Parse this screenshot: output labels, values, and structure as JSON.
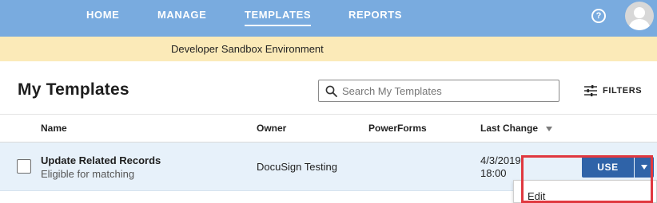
{
  "nav": {
    "items": [
      "HOME",
      "MANAGE",
      "TEMPLATES",
      "REPORTS"
    ],
    "active": "TEMPLATES",
    "help_icon": "help-circle-icon",
    "help_glyph": "?",
    "avatar_icon": "user-avatar-icon"
  },
  "banner": {
    "text": "Developer Sandbox Environment"
  },
  "page": {
    "title": "My Templates"
  },
  "search": {
    "placeholder": "Search My Templates",
    "value": "",
    "icon": "search-icon"
  },
  "filters": {
    "label": "FILTERS",
    "icon": "filters-icon"
  },
  "table": {
    "columns": [
      "Name",
      "Owner",
      "PowerForms",
      "Last Change"
    ],
    "sort_icon": "sort-down-icon",
    "rows": [
      {
        "name": "Update Related Records",
        "subtitle": "Eligible for matching",
        "owner": "DocuSign Testing",
        "powerforms": "",
        "date": "4/3/2019",
        "time": "18:00",
        "action_label": "USE"
      }
    ]
  },
  "menu": {
    "items": [
      "Edit"
    ]
  },
  "colors": {
    "nav_bg": "#79abdf",
    "banner_bg": "#fbeab8",
    "row_bg": "#e7f1fa",
    "primary_button": "#2f63a8",
    "highlight": "#e0383f"
  }
}
